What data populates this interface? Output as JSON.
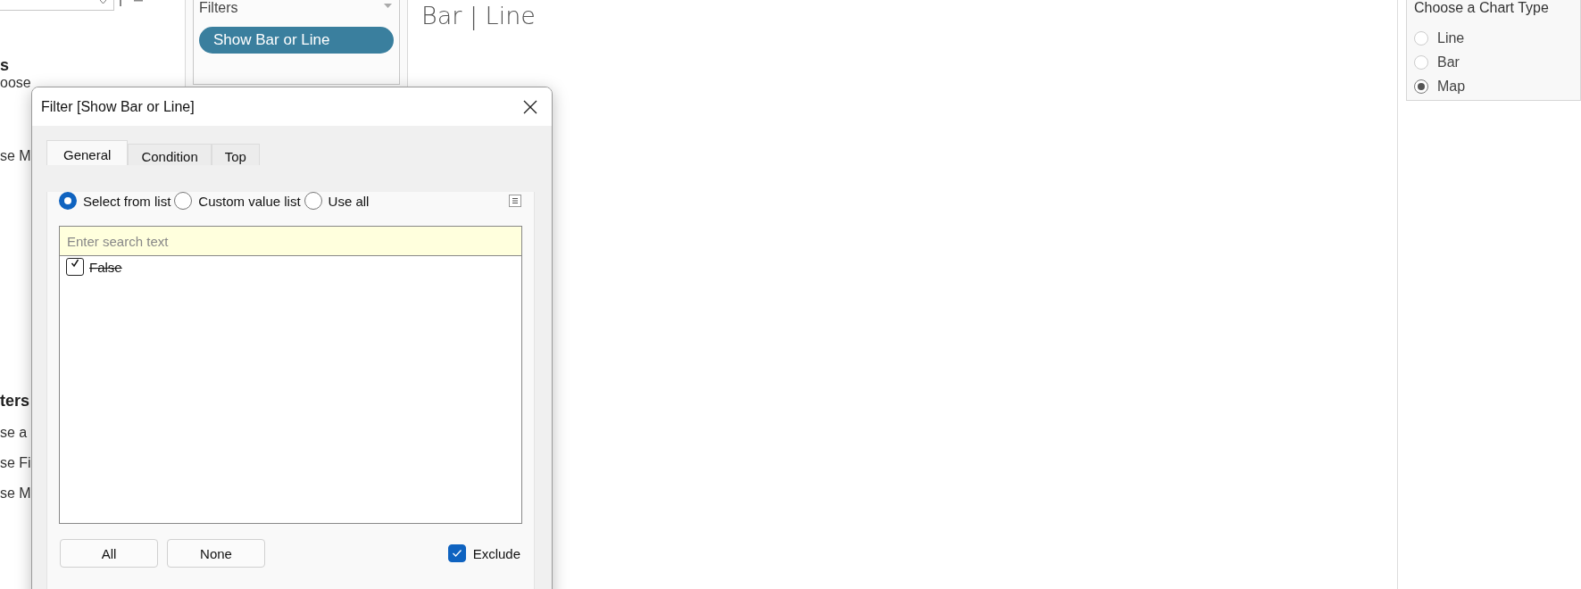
{
  "left_panel": {
    "sections": [
      {
        "heading": "s",
        "items": [
          "oose",
          "se M"
        ]
      },
      {
        "heading": "ters",
        "items": [
          "se a",
          "se Fi",
          "se M"
        ]
      }
    ]
  },
  "filters_shelf": {
    "title": "Filters",
    "pills": [
      "Show Bar or Line"
    ]
  },
  "sheet": {
    "title": "Bar | Line"
  },
  "parameter": {
    "title": "Choose a Chart Type",
    "options": [
      {
        "label": "Line",
        "selected": false
      },
      {
        "label": "Bar",
        "selected": false
      },
      {
        "label": "Map",
        "selected": true
      }
    ]
  },
  "dialog": {
    "title": "Filter [Show Bar or Line]",
    "tabs": [
      {
        "label": "General",
        "selected": true
      },
      {
        "label": "Condition",
        "selected": false
      },
      {
        "label": "Top",
        "selected": false
      }
    ],
    "modes": [
      {
        "label": "Select from list",
        "selected": true
      },
      {
        "label": "Custom value list",
        "selected": false
      },
      {
        "label": "Use all",
        "selected": false
      }
    ],
    "search": {
      "placeholder": "Enter search text"
    },
    "values": [
      {
        "label": "False",
        "checked": true
      }
    ],
    "buttons": [
      "All",
      "None"
    ],
    "exclude": {
      "label": "Exclude",
      "checked": true
    }
  }
}
